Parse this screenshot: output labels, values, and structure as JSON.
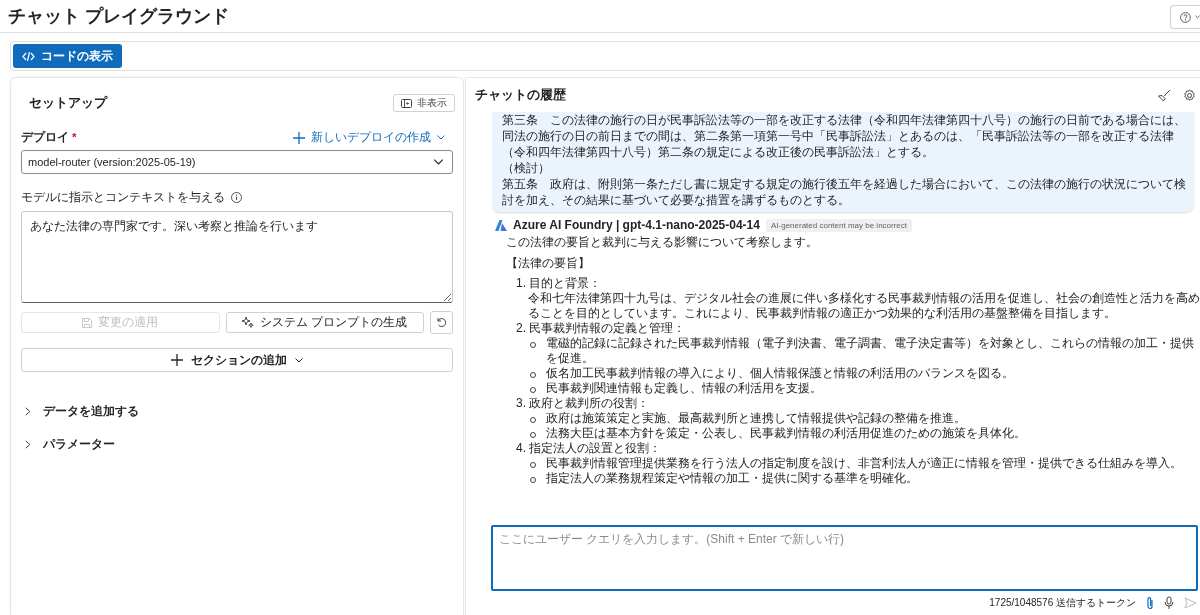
{
  "header": {
    "title": "チャット プレイグラウンド"
  },
  "toolbar": {
    "code_button": "コードの表示"
  },
  "setup": {
    "title": "セットアップ",
    "hide_button": "非表示",
    "deploy_label": "デプロイ",
    "required_mark": "*",
    "new_deploy": "新しいデプロイの作成",
    "deployment": "model-router (version:2025-05-19)",
    "instructions_label": "モデルに指示とコンテキストを与える",
    "instructions": "あなた法律の専門家です。深い考察と推論を行います",
    "apply_button": {
      "label": "変更の適用",
      "disabled": true
    },
    "generate_button": {
      "label": "システム プロンプトの生成",
      "disabled": false
    },
    "add_section": "セクションの追加",
    "sections": [
      {
        "label": "データを追加する",
        "expanded": false
      },
      {
        "label": "パラメーター",
        "expanded": false
      }
    ]
  },
  "chat": {
    "title": "チャットの履歴",
    "user_message": [
      "第三条　この法律の施行の日が民事訴訟法等の一部を改正する法律（令和四年法律第四十八号）の施行の日前である場合には、同法の施行の日の前日までの間は、第二条第一項第一号中「民事訴訟法」とあるのは、「民事訴訟法等の一部を改正する法律（令和四年法律第四十八号）第二条の規定による改正後の民事訴訟法」とする。",
      "（検討）",
      "第五条　政府は、附則第一条ただし書に規定する規定の施行後五年を経過した場合において、この法律の施行の状況について検討を加え、その結果に基づいて必要な措置を講ずるものとする。"
    ],
    "assistant": {
      "name": "Azure AI Foundry | gpt-4.1-nano-2025-04-14",
      "badge": "AI-generated content may be incorrect",
      "intro": "この法律の要旨と裁判に与える影響について考察します。",
      "heading": "【法律の要旨】",
      "items": [
        {
          "number": "1.",
          "title": "目的と背景：",
          "text": "令和七年法律第四十九号は、デジタル社会の進展に伴い多様化する民事裁判情報の活用を促進し、社会の創造性と活力を高めることを目的としています。これにより、民事裁判情報の適正かつ効果的な利活用の基盤整備を目指します。"
        },
        {
          "number": "2.",
          "title": "民事裁判情報の定義と管理：",
          "bullets": [
            "電磁的記録に記録された民事裁判情報（電子判決書、電子調書、電子決定書等）を対象とし、これらの情報の加工・提供を促進。",
            "仮名加工民事裁判情報の導入により、個人情報保護と情報の利活用のバランスを図る。",
            "民事裁判関連情報も定義し、情報の利活用を支援。"
          ]
        },
        {
          "number": "3.",
          "title": "政府と裁判所の役割：",
          "bullets": [
            "政府は施策策定と実施、最高裁判所と連携して情報提供や記録の整備を推進。",
            "法務大臣は基本方針を策定・公表し、民事裁判情報の利活用促進のための施策を具体化。"
          ]
        },
        {
          "number": "4.",
          "title": "指定法人の設置と役割：",
          "bullets": [
            "民事裁判情報管理提供業務を行う法人の指定制度を設け、非営利法人が適正に情報を管理・提供できる仕組みを導入。",
            "指定法人の業務規程策定や情報の加工・提供に関する基準を明確化。"
          ]
        }
      ]
    },
    "input": {
      "placeholder": "ここにユーザー クエリを入力します。(Shift + Enter で新しい行)"
    },
    "token_count": "1725/1048576 送信するトークン"
  }
}
